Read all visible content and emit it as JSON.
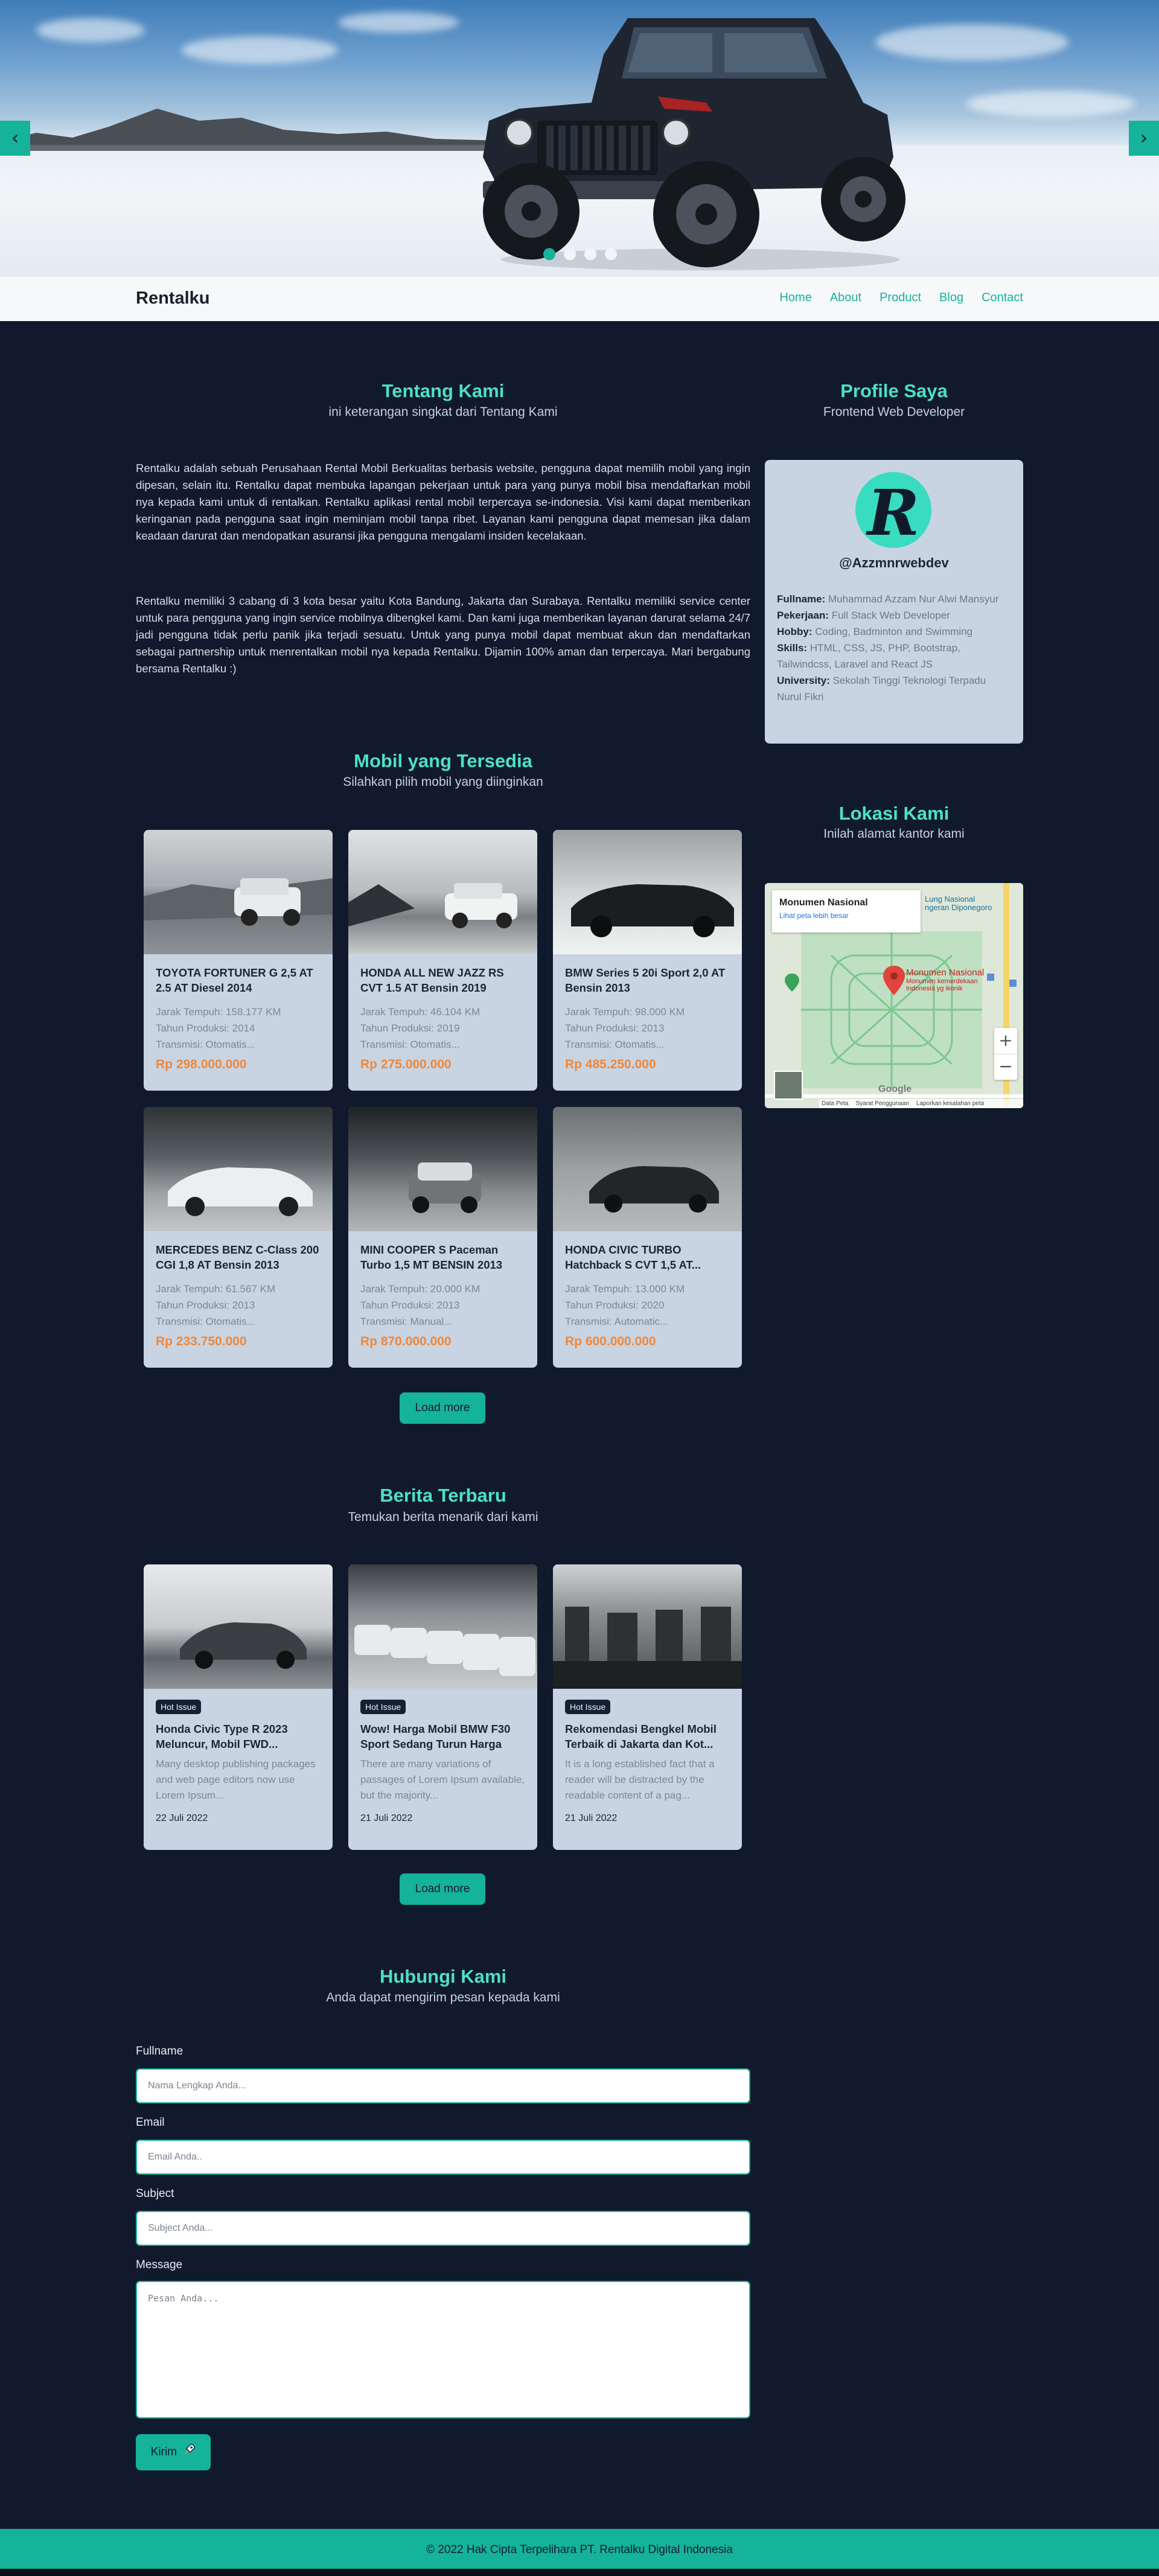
{
  "hero": {
    "prev_icon": "chevron-left-icon",
    "next_icon": "chevron-right-icon",
    "prev_glyph": "‹",
    "next_glyph": "›",
    "slides": 4,
    "active_slide": 1
  },
  "nav": {
    "brand": "Rentalku",
    "links": [
      "Home",
      "About",
      "Product",
      "Blog",
      "Contact"
    ]
  },
  "about": {
    "title": "Tentang Kami",
    "subtitle": "ini keterangan singkat dari Tentang Kami",
    "p1": "Rentalku adalah sebuah Perusahaan Rental Mobil Berkualitas berbasis website, pengguna dapat memilih mobil yang ingin dipesan, selain itu. Rentalku dapat membuka lapangan pekerjaan untuk para yang punya mobil bisa mendaftarkan mobil nya kepada kami untuk di rentalkan. Rentalku aplikasi rental mobil terpercaya se-indonesia. Visi kami dapat memberikan keringanan pada pengguna saat ingin meminjam mobil tanpa ribet. Layanan kami pengguna dapat memesan jika dalam keadaan darurat dan mendopatkan asuransi jika pengguna mengalami insiden kecelakaan.",
    "p2": "Rentalku memiliki 3 cabang di 3 kota besar yaitu Kota Bandung, Jakarta dan Surabaya. Rentalku memiliki service center untuk para pengguna yang ingin service mobilnya dibengkel kami. Dan kami juga memberikan layanan darurat selama 24/7 jadi pengguna tidak perlu panik jika terjadi sesuatu. Untuk yang punya mobil dapat membuat akun dan mendaftarkan sebagai partnership untuk menrentalkan mobil nya kepada Rentalku. Dijamin 100% aman dan terpercaya. Mari bergabung bersama Rentalku :)"
  },
  "profile": {
    "title": "Profile Saya",
    "subtitle": "Frontend Web Developer",
    "avatar_letter": "R",
    "handle": "@Azzmnrwebdev",
    "fields": [
      {
        "label": "Fullname:",
        "value": " Muhammad Azzam Nur Alwi Mansyur"
      },
      {
        "label": "Pekerjaan:",
        "value": " Full Stack Web Developer"
      },
      {
        "label": "Hobby:",
        "value": " Coding, Badminton and Swimming"
      },
      {
        "label": "Skills:",
        "value": " HTML, CSS, JS, PHP, Bootstrap, Tailwindcss, Laravel and React JS"
      },
      {
        "label": "University:",
        "value": " Sekolah Tinggi Teknologi Terpadu Nurul Fikri"
      }
    ]
  },
  "cars": {
    "title": "Mobil yang Tersedia",
    "subtitle": "Silahkan pilih mobil yang diinginkan",
    "items": [
      {
        "name": "TOYOTA FORTUNER G 2,5 AT 2.5 AT Diesel 2014",
        "km": "Jarak Tempuh: 158.177 KM",
        "year": "Tahun Produksi: 2014",
        "trans": "Transmisi: Otomatis...",
        "price": "Rp 298.000.000"
      },
      {
        "name": "HONDA ALL NEW JAZZ RS CVT 1.5 AT Bensin 2019",
        "km": "Jarak Tempuh: 46.104 KM",
        "year": "Tahun Produksi: 2019",
        "trans": "Transmisi: Otomatis...",
        "price": "Rp 275.000.000"
      },
      {
        "name": "BMW Series 5 20i Sport 2,0 AT Bensin 2013",
        "km": "Jarak Tempuh: 98.000 KM",
        "year": "Tahun Produksi: 2013",
        "trans": "Transmisi: Otomatis...",
        "price": "Rp 485.250.000"
      },
      {
        "name": "MERCEDES BENZ C-Class 200 CGI 1,8 AT Bensin 2013",
        "km": "Jarak Tempuh: 61.567 KM",
        "year": "Tahun Produksi: 2013",
        "trans": "Transmisi: Otomatis...",
        "price": "Rp 233.750.000"
      },
      {
        "name": "MINI COOPER S Paceman Turbo 1,5 MT BENSIN 2013",
        "km": "Jarak Tempuh: 20.000 KM",
        "year": "Tahun Produksi: 2013",
        "trans": "Transmisi: Manual...",
        "price": "Rp 870.000.000"
      },
      {
        "name": "HONDA CIVIC TURBO Hatchback S CVT 1,5 AT...",
        "km": "Jarak Tempuh: 13.000 KM",
        "year": "Tahun Produksi: 2020",
        "trans": "Transmisi: Automatic...",
        "price": "Rp 600.000.000"
      }
    ],
    "load_more": "Load more"
  },
  "location": {
    "title": "Lokasi Kami",
    "subtitle": "Inilah alamat kantor kami",
    "place_name": "Monumen Nasional",
    "place_link": "Lihat peta lebih besar",
    "pin_title": "Monumen Nasional",
    "pin_sub": "Monumen kemerdekaan Indonesia yg ikonik",
    "area_label": "Lung Nasional\nngeran Diponegoro",
    "zoom_in": "+",
    "zoom_out": "−",
    "google": "Google",
    "footer_items": [
      "Data Peta",
      "Syarat Penggunaan",
      "Laporkan kesalahan peta"
    ]
  },
  "news": {
    "title": "Berita Terbaru",
    "subtitle": "Temukan berita menarik dari kami",
    "items": [
      {
        "badge": "Hot Issue",
        "title": "Honda Civic Type R 2023 Meluncur, Mobil FWD...",
        "excerpt": "Many desktop publishing packages and web page editors now use Lorem Ipsum...",
        "date": "22 Juli 2022"
      },
      {
        "badge": "Hot Issue",
        "title": "Wow! Harga Mobil BMW F30 Sport Sedang Turun Harga",
        "excerpt": "There are many variations of passages of Lorem Ipsum available, but the majority...",
        "date": "21 Juli 2022"
      },
      {
        "badge": "Hot Issue",
        "title": "Rekomendasi Bengkel Mobil Terbaik di Jakarta dan Kot...",
        "excerpt": "It is a long established fact that a reader will be distracted by the readable content of a pag...",
        "date": "21 Juli 2022"
      }
    ],
    "load_more": "Load more"
  },
  "contact": {
    "title": "Hubungi Kami",
    "subtitle": "Anda dapat mengirim pesan kepada kami",
    "fullname_label": "Fullname",
    "fullname_placeholder": "Nama Lengkap Anda...",
    "email_label": "Email",
    "email_placeholder": "Email Anda..",
    "subject_label": "Subject",
    "subject_placeholder": "Subject Anda...",
    "message_label": "Message",
    "message_placeholder": "Pesan Anda...",
    "submit": "Kirim",
    "submit_icon": "rocket-icon"
  },
  "footer": {
    "text": "© 2022 Hak Cipta Terpelihara PT. Rentalku Digital Indonesia"
  },
  "colors": {
    "accent": "#14b39a",
    "title": "#4ce0c8",
    "background": "#111a2c",
    "card": "#c9d4e2",
    "price": "#f0873a"
  }
}
